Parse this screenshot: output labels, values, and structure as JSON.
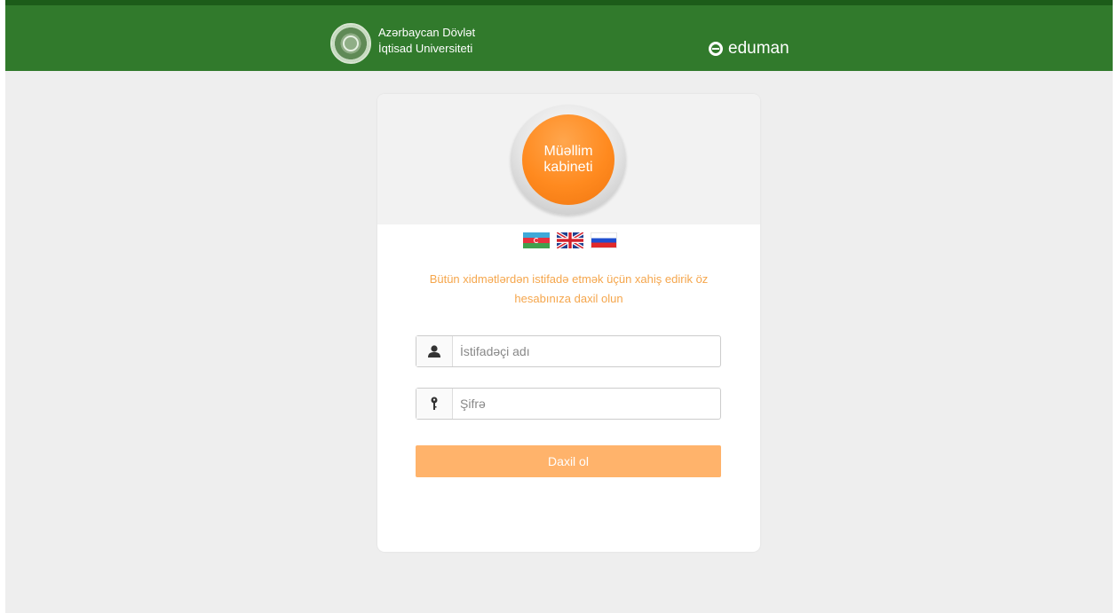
{
  "header": {
    "university_name_line1": "Azərbaycan Dövlət",
    "university_name_line2": "İqtisad Universiteti",
    "brand": "eduman",
    "colors": {
      "bar": "#317a2c",
      "bar_top": "#1c5c19"
    }
  },
  "card": {
    "badge_line1": "Müəllim",
    "badge_line2": "kabineti",
    "languages": [
      {
        "code": "az",
        "icon": "azerbaijan-flag-icon"
      },
      {
        "code": "en",
        "icon": "uk-flag-icon"
      },
      {
        "code": "ru",
        "icon": "russia-flag-icon"
      }
    ],
    "prompt_line1": "Bütün xidmətlərdən istifadə etmək üçün xahiş edirik öz",
    "prompt_line2": "hesabınıza daxil olun",
    "username": {
      "placeholder": "İstifadəçi adı",
      "value": "",
      "icon": "user-icon"
    },
    "password": {
      "placeholder": "Şifrə",
      "value": "",
      "icon": "key-icon"
    },
    "login_label": "Daxil ol",
    "colors": {
      "accent": "#ff8a1f",
      "button": "#ffb36b",
      "prompt": "#f5a64c"
    }
  }
}
